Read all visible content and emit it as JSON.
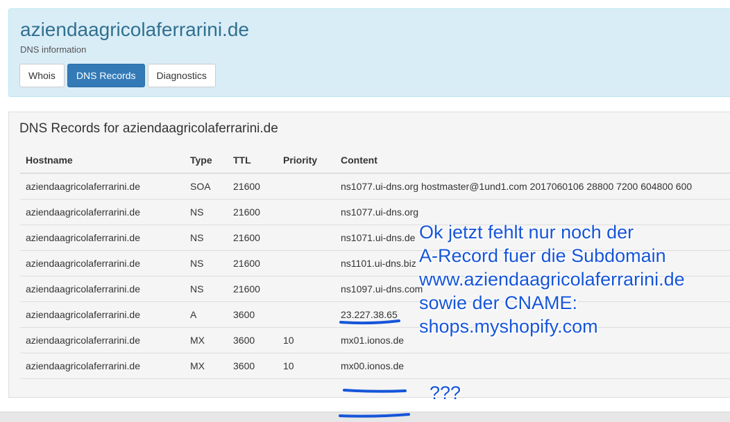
{
  "header": {
    "title": "aziendaagricolaferrarini.de",
    "subtitle": "DNS information"
  },
  "tabs": [
    {
      "label": "Whois",
      "active": false
    },
    {
      "label": "DNS Records",
      "active": true
    },
    {
      "label": "Diagnostics",
      "active": false
    }
  ],
  "panel": {
    "heading": "DNS Records for aziendaagricolaferrarini.de"
  },
  "table": {
    "columns": [
      "Hostname",
      "Type",
      "TTL",
      "Priority",
      "Content"
    ],
    "rows": [
      [
        "aziendaagricolaferrarini.de",
        "SOA",
        "21600",
        "",
        "ns1077.ui-dns.org hostmaster@1und1.com 2017060106 28800 7200 604800 600"
      ],
      [
        "aziendaagricolaferrarini.de",
        "NS",
        "21600",
        "",
        "ns1077.ui-dns.org"
      ],
      [
        "aziendaagricolaferrarini.de",
        "NS",
        "21600",
        "",
        "ns1071.ui-dns.de"
      ],
      [
        "aziendaagricolaferrarini.de",
        "NS",
        "21600",
        "",
        "ns1101.ui-dns.biz"
      ],
      [
        "aziendaagricolaferrarini.de",
        "NS",
        "21600",
        "",
        "ns1097.ui-dns.com"
      ],
      [
        "aziendaagricolaferrarini.de",
        "A",
        "3600",
        "",
        "23.227.38.65"
      ],
      [
        "aziendaagricolaferrarini.de",
        "MX",
        "3600",
        "10",
        "mx01.ionos.de"
      ],
      [
        "aziendaagricolaferrarini.de",
        "MX",
        "3600",
        "10",
        "mx00.ionos.de"
      ]
    ]
  },
  "annotation": {
    "lines": [
      "Ok jetzt fehlt nur noch der",
      "A-Record fuer die Subdomain",
      "www.aziendaagricolaferrarini.de",
      "sowie der CNAME:",
      "shops.myshopify.com"
    ],
    "question": "???",
    "color": "#1655d9"
  },
  "colors": {
    "header_bg": "#d9edf7",
    "header_title": "#31708f",
    "active_tab": "#337ab7",
    "panel_bg": "#f5f5f5"
  }
}
